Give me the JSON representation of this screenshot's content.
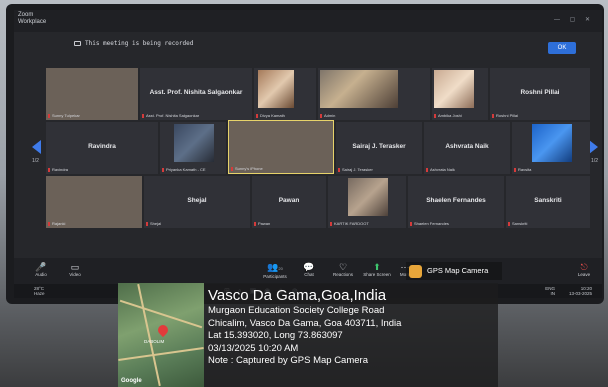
{
  "app": {
    "title": "Zoom\nWorkplace"
  },
  "recording": {
    "text": "This meeting is being recorded",
    "ok_label": "OK"
  },
  "pages": {
    "left": "1/2",
    "right": "1/2"
  },
  "tiles": [
    {
      "caption": "Sunny Tulpekar",
      "center": ""
    },
    {
      "caption": "Asst. Prof. Nishita Salgaonkar",
      "center": "Asst. Prof. Nishita Salgaonkar"
    },
    {
      "caption": "Divya Kamath",
      "center": ""
    },
    {
      "caption": "Admin",
      "center": ""
    },
    {
      "caption": "Ambika Joshi",
      "center": ""
    },
    {
      "caption": "Roshni Pillai",
      "center": "Roshni Pillai"
    },
    {
      "caption": "Ravindra",
      "center": "Ravindra"
    },
    {
      "caption": "Priyanka Kamath - CE",
      "center": ""
    },
    {
      "caption": "Sunny's iPhone",
      "center": ""
    },
    {
      "caption": "Sairaj J. Terasker",
      "center": "Sairaj J. Terasker"
    },
    {
      "caption": "Ashvrata Naik",
      "center": "Ashvrata Naik"
    },
    {
      "caption": "Ravsita",
      "center": ""
    },
    {
      "caption": "Rajanki",
      "center": ""
    },
    {
      "caption": "Shejal",
      "center": "Shejal"
    },
    {
      "caption": "Pawan",
      "center": "Pawan"
    },
    {
      "caption": "KARTIK FARDOOT",
      "center": ""
    },
    {
      "caption": "Shaelen Fernandes",
      "center": "Shaelen Fernandes"
    },
    {
      "caption": "Sanskriti",
      "center": "Sanskriti"
    }
  ],
  "controls": {
    "audio": "Audio",
    "video": "Video",
    "participants": "Participants",
    "participants_count": "20",
    "chat": "Chat",
    "reactions": "Reactions",
    "share": "Share Screen",
    "more": "More",
    "leave": "Leave"
  },
  "taskbar": {
    "weather": "28°C\nHaze",
    "lang": "ENG\nIN",
    "time": "10:20",
    "date": "13-03-2025"
  },
  "gps": {
    "badge": "GPS Map Camera",
    "title": "Vasco Da Gama,Goa,India",
    "line1": "Murgaon Education Society College Road",
    "line2": "Chicalim, Vasco Da Gama, Goa 403711, India",
    "line3": "Lat 15.393020, Long 73.863097",
    "line4": "03/13/2025 10:20 AM",
    "line5": "Note : Captured by GPS Map Camera",
    "map_brand": "Google",
    "map_place": "DABOLIM"
  },
  "colors": {
    "accent": "#2e6fd9",
    "nav_arrow": "#3f7bea",
    "rec_mark": "#d43b3b"
  }
}
